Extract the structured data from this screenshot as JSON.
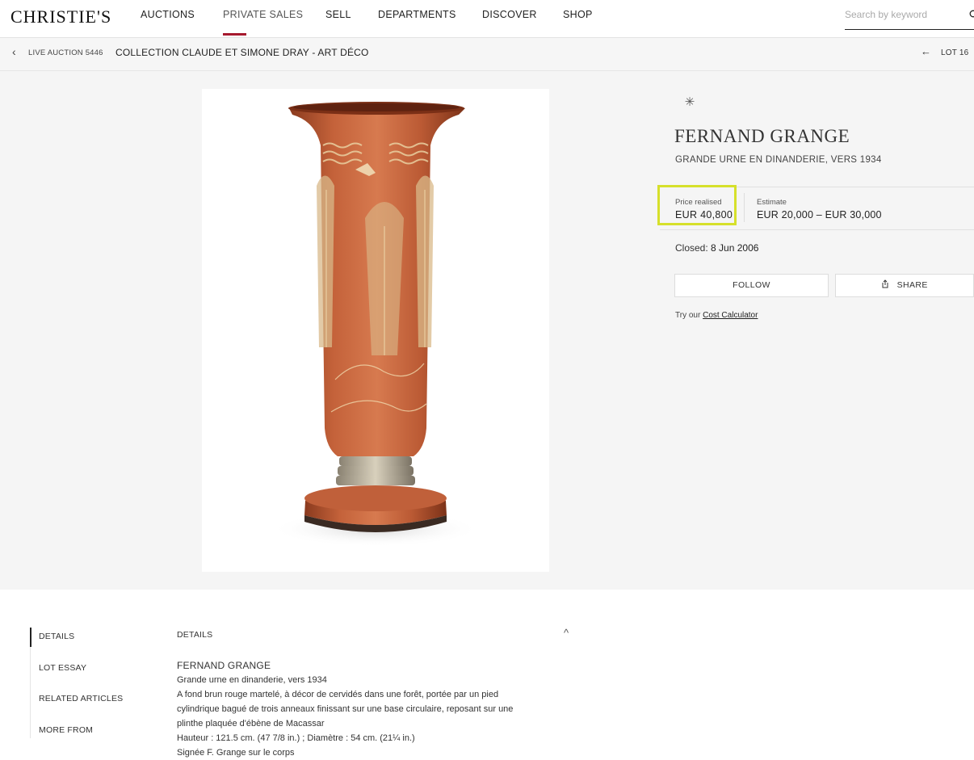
{
  "nav": {
    "logo": "CHRISTIE'S",
    "items": [
      "AUCTIONS",
      "PRIVATE SALES",
      "SELL",
      "DEPARTMENTS",
      "DISCOVER",
      "SHOP"
    ],
    "search_placeholder": "Search by keyword"
  },
  "breadcrumb": {
    "small": "LIVE AUCTION 5446",
    "title": "COLLECTION CLAUDE ET SIMONE DRAY - ART DÉCO",
    "lot": "LOT 16"
  },
  "lot": {
    "artist": "FERNAND GRANGE",
    "subtitle": "GRANDE URNE EN DINANDERIE, VERS 1934",
    "price_label": "Price realised",
    "price_value": "EUR 40,800",
    "estimate_label": "Estimate",
    "estimate_value": "EUR 20,000 – EUR 30,000",
    "closed_label": "Closed:",
    "closed_date": "8 Jun 2006",
    "follow_label": "FOLLOW",
    "share_label": "SHARE",
    "cost_prefix": "Try our",
    "cost_link": "Cost Calculator"
  },
  "details": {
    "tabs": [
      "DETAILS",
      "LOT ESSAY",
      "RELATED ARTICLES",
      "MORE FROM"
    ],
    "heading": "DETAILS",
    "lines": [
      "FERNAND GRANGE",
      "Grande urne en dinanderie, vers 1934",
      "A fond brun rouge martelé, à décor de cervidés dans une forêt, portée par un pied",
      "cylindrique bagué de trois anneaux finissant sur une base circulaire, reposant sur une",
      "plinthe plaquée d'ébène de Macassar",
      "Hauteur : 121.5 cm. (47 7/8 in.) ; Diamètre : 54 cm. (21¼ in.)",
      "Signée F. Grange sur le corps"
    ]
  },
  "colors": {
    "accent": "#a6192e",
    "highlight": "#d6e02b"
  }
}
